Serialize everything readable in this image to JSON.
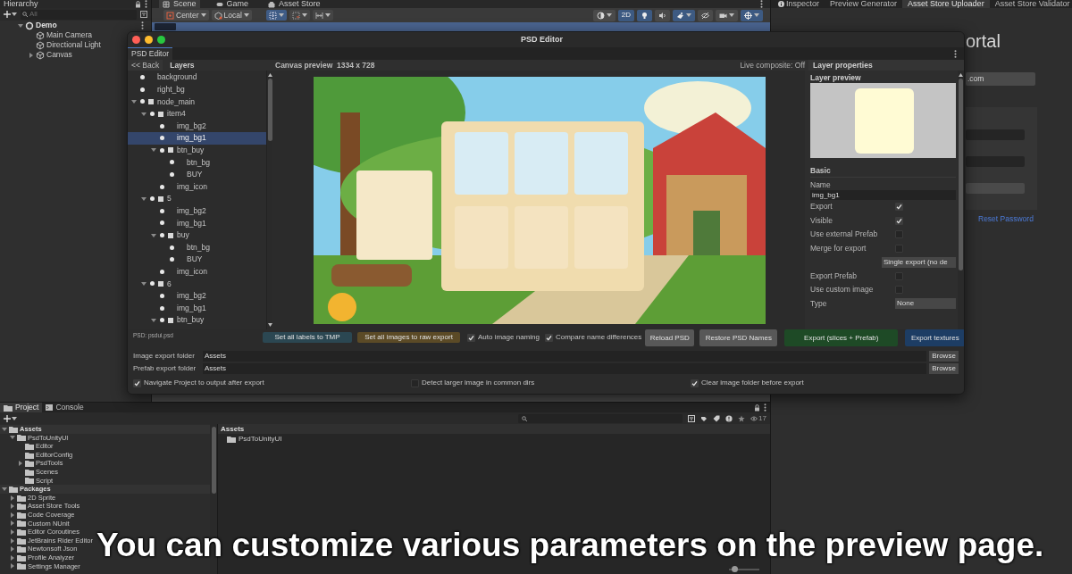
{
  "hierarchy": {
    "tab": "Hierarchy",
    "search_placeholder": "All",
    "items": [
      {
        "label": "Demo",
        "kind": "scene",
        "expanded": true,
        "children": [
          {
            "label": "Main Camera",
            "kind": "object"
          },
          {
            "label": "Directional Light",
            "kind": "object"
          },
          {
            "label": "Canvas",
            "kind": "object",
            "expanded": false
          }
        ]
      }
    ]
  },
  "scene": {
    "tabs": [
      {
        "label": "Scene",
        "selected": true
      },
      {
        "label": "Game",
        "selected": false
      },
      {
        "label": "Asset Store",
        "selected": false
      }
    ],
    "pivot": "Center",
    "space": "Local",
    "view_toggles": [
      {
        "kind": "shading",
        "on": false
      },
      {
        "kind": "dimension",
        "label": "2D",
        "on": true
      },
      {
        "kind": "lighting",
        "on": true
      },
      {
        "kind": "audio",
        "on": false
      },
      {
        "kind": "effects",
        "on": true
      },
      {
        "kind": "visibility",
        "on": false
      },
      {
        "kind": "camera",
        "on": false
      },
      {
        "kind": "gizmos",
        "on": true
      }
    ]
  },
  "inspector": {
    "tabs": [
      {
        "label": "Inspector",
        "selected": false
      },
      {
        "label": "Preview Generator",
        "selected": false
      },
      {
        "label": "Asset Store Uploader",
        "selected": true
      },
      {
        "label": "Asset Store Validator",
        "selected": false
      }
    ],
    "logo_text": "ortal",
    "email_value": ".com",
    "reset_link": "Reset Password"
  },
  "psd_editor": {
    "title": "PSD Editor",
    "tab": "PSD Editor",
    "back": "<< Back",
    "layers_title": "Layers",
    "canvas_title": "Canvas preview  1334 x 728",
    "live_composite": "Live composite: Off",
    "properties_title": "Layer properties",
    "layers": [
      {
        "label": "background",
        "selected": false
      },
      {
        "label": "right_bg",
        "selected": false
      },
      {
        "label": "node_main",
        "selected": false,
        "expanded": true,
        "children": [
          {
            "label": "item4",
            "selected": false,
            "expanded": true,
            "children": [
              {
                "label": "img_bg2",
                "selected": false
              },
              {
                "label": "img_bg1",
                "selected": true
              },
              {
                "label": "btn_buy",
                "selected": false,
                "expanded": true,
                "children": [
                  {
                    "label": "btn_bg",
                    "selected": false
                  },
                  {
                    "label": "BUY",
                    "selected": false
                  }
                ]
              },
              {
                "label": "img_icon",
                "selected": false
              }
            ]
          },
          {
            "label": "5",
            "selected": false,
            "expanded": true,
            "children": [
              {
                "label": "img_bg2",
                "selected": false
              },
              {
                "label": "img_bg1",
                "selected": false
              },
              {
                "label": "buy",
                "selected": false,
                "expanded": true,
                "children": [
                  {
                    "label": "btn_bg",
                    "selected": false
                  },
                  {
                    "label": "BUY",
                    "selected": false
                  }
                ]
              },
              {
                "label": "img_icon",
                "selected": false
              }
            ]
          },
          {
            "label": "6",
            "selected": false,
            "expanded": true,
            "children": [
              {
                "label": "img_bg2",
                "selected": false
              },
              {
                "label": "img_bg1",
                "selected": false
              },
              {
                "label": "btn_buy",
                "selected": false,
                "expanded": true
              }
            ]
          }
        ]
      }
    ],
    "layer_preview_title": "Layer preview",
    "basic_title": "Basic",
    "name_field": {
      "label": "Name",
      "value": "img_bg1"
    },
    "properties": [
      {
        "kind": "checkbox",
        "label": "Export",
        "checked": true
      },
      {
        "kind": "checkbox",
        "label": "Visible",
        "checked": true
      },
      {
        "kind": "checkbox",
        "label": "Use external Prefab",
        "checked": false
      },
      {
        "kind": "checkbox",
        "label": "Merge for export",
        "checked": false
      },
      {
        "kind": "dropdown",
        "value": "Single export (no de"
      },
      {
        "kind": "checkbox",
        "label": "Export Prefab",
        "checked": false
      },
      {
        "kind": "checkbox",
        "label": "Use custom image",
        "checked": false
      },
      {
        "kind": "dropdown",
        "label": "Type",
        "value": "None"
      }
    ],
    "psd_file": "PSD: psdui.psd",
    "actions": [
      {
        "kind": "button",
        "label": "Set all labels to TMP",
        "color": "#2b4752"
      },
      {
        "kind": "button",
        "label": "Set all images to raw export",
        "color": "#5b4a26"
      },
      {
        "kind": "checkbox",
        "label": "Auto image naming",
        "checked": true
      },
      {
        "kind": "checkbox",
        "label": "Compare name differences",
        "checked": true
      },
      {
        "kind": "button",
        "label": "Reload PSD",
        "color": "#585858"
      },
      {
        "kind": "button",
        "label": "Restore PSD Names",
        "color": "#585858"
      },
      {
        "kind": "button",
        "label": "Export (slices + Prefab)",
        "color": "#1e4a26"
      },
      {
        "kind": "button",
        "label": "Export textures",
        "color": "#1d3d64"
      }
    ],
    "folders": [
      {
        "label": "Image export folder",
        "value": "Assets",
        "button": "Browse"
      },
      {
        "label": "Prefab export folder",
        "value": "Assets",
        "button": "Browse"
      }
    ],
    "options": [
      {
        "label": "Navigate Project to output after export",
        "checked": true
      },
      {
        "label": "Detect larger image in common dirs",
        "checked": false
      },
      {
        "label": "Clear image folder before export",
        "checked": true
      }
    ]
  },
  "project": {
    "tabs": [
      {
        "label": "Project",
        "selected": true
      },
      {
        "label": "Console",
        "selected": false
      }
    ],
    "hidden_count": "17",
    "tree": [
      {
        "label": "Assets",
        "expanded": true,
        "children": [
          {
            "label": "PsdToUnityUI",
            "expanded": true,
            "children": [
              {
                "label": "Editor"
              },
              {
                "label": "EditorConfig"
              },
              {
                "label": "PsdTools",
                "expanded": false
              },
              {
                "label": "Scenes"
              },
              {
                "label": "Script"
              }
            ]
          }
        ]
      },
      {
        "label": "Packages",
        "expanded": true,
        "children": [
          {
            "label": "2D Sprite",
            "expanded": false
          },
          {
            "label": "Asset Store Tools",
            "expanded": false
          },
          {
            "label": "Code Coverage",
            "expanded": false
          },
          {
            "label": "Custom NUnit",
            "expanded": false
          },
          {
            "label": "Editor Coroutines",
            "expanded": false
          },
          {
            "label": "JetBrains Rider Editor",
            "expanded": false
          },
          {
            "label": "Newtonsoft Json",
            "expanded": false
          },
          {
            "label": "Profile Analyzer",
            "expanded": false
          },
          {
            "label": "Settings Manager",
            "expanded": false
          }
        ]
      }
    ],
    "breadcrumb": "Assets",
    "items": [
      "PsdToUnityUI"
    ],
    "zoom_slider": {
      "level": 0.1
    }
  },
  "subtitle": "You can customize various parameters on the preview page."
}
